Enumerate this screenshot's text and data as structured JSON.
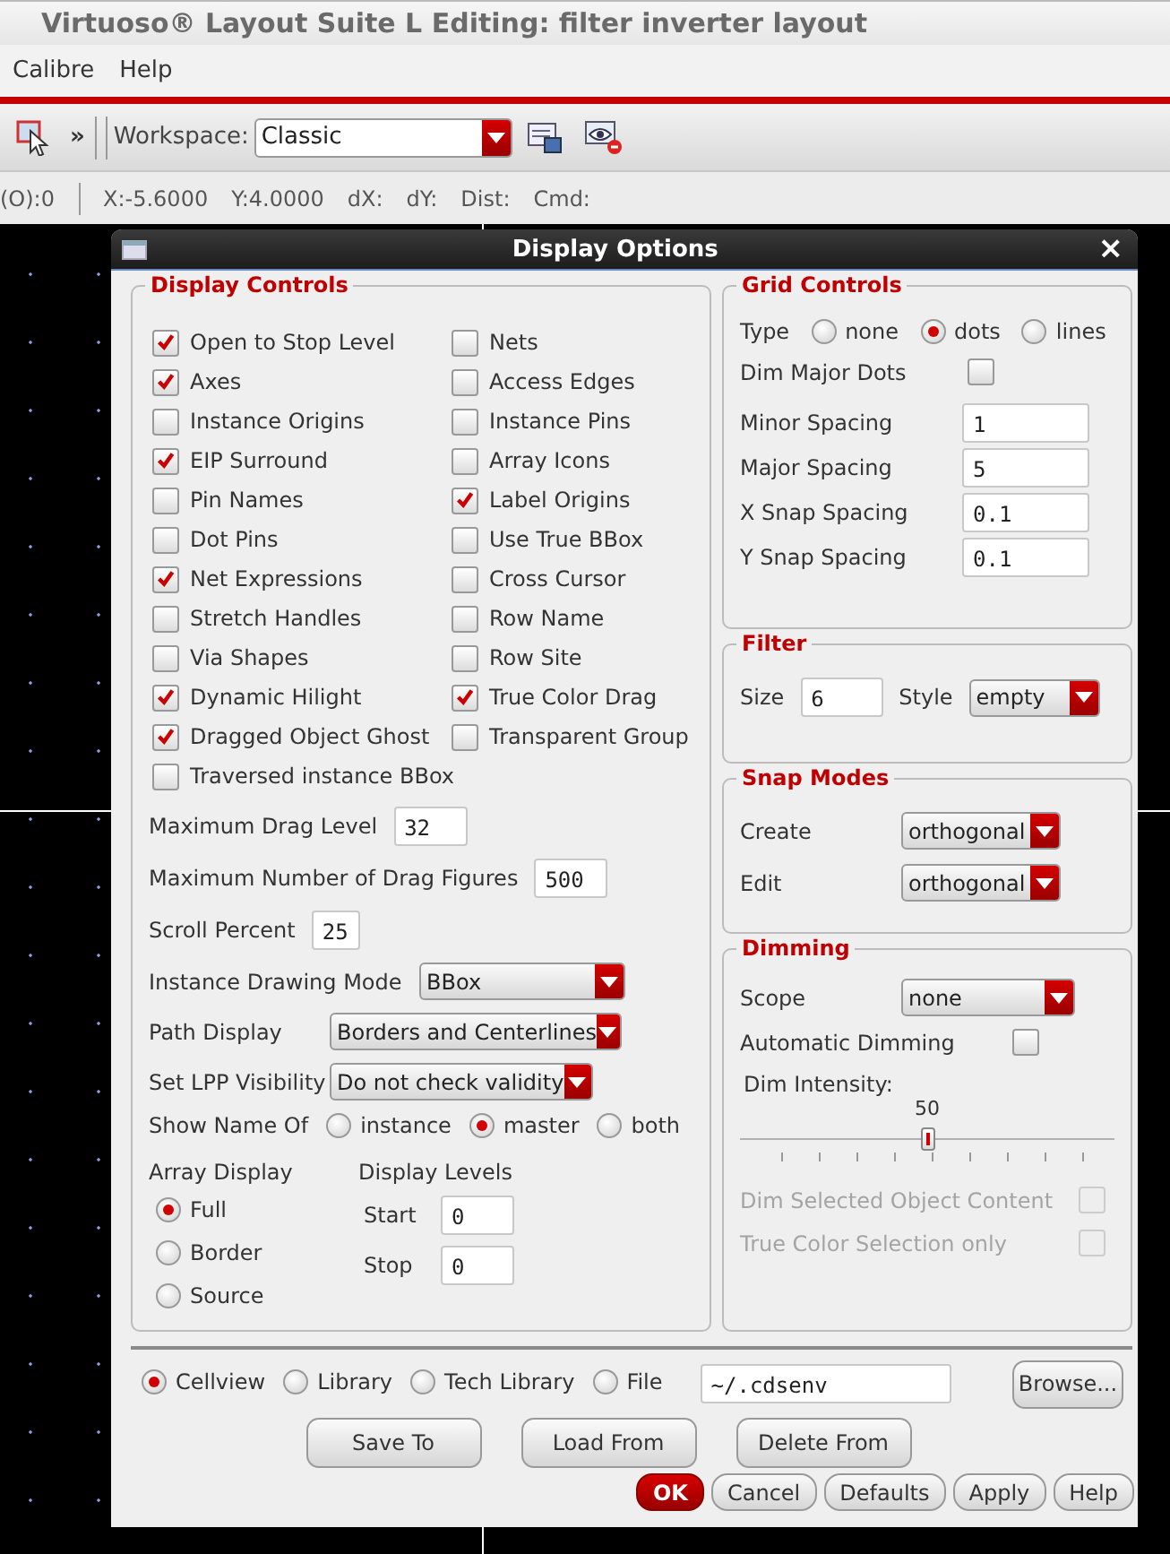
{
  "window": {
    "title": "Virtuoso® Layout Suite L Editing: filter inverter layout"
  },
  "menu_bar": [
    "Calibre",
    "Help"
  ],
  "toolbar": {
    "overflow": "»",
    "workspace_label": "Workspace:",
    "workspace": "Classic"
  },
  "status_bar": [
    "(O):0",
    "X:-5.6000",
    "Y:4.0000",
    "dX:",
    "dY:",
    "Dist:",
    "Cmd:"
  ],
  "dialog": {
    "title": "Display Options",
    "close": "×",
    "display_controls": {
      "title": "Display Controls",
      "column_1": [
        {
          "label": "Open to Stop Level",
          "checked": true
        },
        {
          "label": "Axes",
          "checked": true
        },
        {
          "label": "Instance Origins",
          "checked": false
        },
        {
          "label": "EIP Surround",
          "checked": true
        },
        {
          "label": "Pin Names",
          "checked": false
        },
        {
          "label": "Dot Pins",
          "checked": false
        },
        {
          "label": "Net Expressions",
          "checked": true
        },
        {
          "label": "Stretch Handles",
          "checked": false
        },
        {
          "label": "Via Shapes",
          "checked": false
        },
        {
          "label": "Dynamic Hilight",
          "checked": true
        },
        {
          "label": "Dragged Object Ghost",
          "checked": true
        },
        {
          "label": "Traversed instance BBox",
          "checked": false
        }
      ],
      "column_2": [
        {
          "label": "Nets",
          "checked": false
        },
        {
          "label": "Access Edges",
          "checked": false
        },
        {
          "label": "Instance Pins",
          "checked": false
        },
        {
          "label": "Array Icons",
          "checked": false
        },
        {
          "label": "Label Origins",
          "checked": true
        },
        {
          "label": "Use True BBox",
          "checked": false
        },
        {
          "label": "Cross Cursor",
          "checked": false
        },
        {
          "label": "Row Name",
          "checked": false
        },
        {
          "label": "Row Site",
          "checked": false
        },
        {
          "label": "True Color Drag",
          "checked": true
        },
        {
          "label": "Transparent Group",
          "checked": false
        }
      ],
      "fields": [
        {
          "label": "Maximum Drag Level",
          "value": "32"
        },
        {
          "label": "Maximum Number of Drag Figures",
          "value": "500"
        },
        {
          "label": "Scroll Percent",
          "value": "25"
        }
      ],
      "dropdowns": [
        {
          "label": "Instance Drawing Mode",
          "value": "BBox"
        },
        {
          "label": "Path Display",
          "value": "Borders and Centerlines"
        },
        {
          "label": "Set LPP Visibility",
          "value": "Do not check validity"
        }
      ],
      "show_name_of": {
        "label": "Show Name Of",
        "options": [
          {
            "label": "instance",
            "selected": false
          },
          {
            "label": "master",
            "selected": true
          },
          {
            "label": "both",
            "selected": false
          }
        ]
      },
      "array_display": {
        "label": "Array Display",
        "options": [
          {
            "label": "Full",
            "selected": true
          },
          {
            "label": "Border",
            "selected": false
          },
          {
            "label": "Source",
            "selected": false
          }
        ]
      },
      "display_levels": {
        "label": "Display Levels",
        "fields": [
          {
            "label": "Start",
            "value": "0"
          },
          {
            "label": "Stop",
            "value": "0"
          }
        ]
      }
    },
    "grid_controls": {
      "title": "Grid Controls",
      "type": {
        "label": "Type",
        "options": [
          {
            "label": "none",
            "selected": false
          },
          {
            "label": "dots",
            "selected": true
          },
          {
            "label": "lines",
            "selected": false
          }
        ]
      },
      "dim_major_dots": {
        "label": "Dim Major Dots",
        "checked": false
      },
      "fields": [
        {
          "label": "Minor Spacing",
          "value": "1"
        },
        {
          "label": "Major Spacing",
          "value": "5"
        },
        {
          "label": "X Snap Spacing",
          "value": "0.1"
        },
        {
          "label": "Y Snap Spacing",
          "value": "0.1"
        }
      ]
    },
    "filter": {
      "title": "Filter",
      "size": {
        "label": "Size",
        "value": "6"
      },
      "style": {
        "label": "Style",
        "value": "empty"
      }
    },
    "snap_modes": {
      "title": "Snap Modes",
      "dropdowns": [
        {
          "label": "Create",
          "value": "orthogonal"
        },
        {
          "label": "Edit",
          "value": "orthogonal"
        }
      ]
    },
    "dimming": {
      "title": "Dimming",
      "scope": {
        "label": "Scope",
        "value": "none"
      },
      "automatic_dimming": {
        "label": "Automatic Dimming",
        "checked": false
      },
      "intensity": {
        "label": "Dim Intensity:",
        "reading": "50",
        "level": 0.5
      },
      "options": [
        {
          "label": "Dim Selected Object Content",
          "checked": false,
          "disabled": true
        },
        {
          "label": "True Color Selection only",
          "checked": false,
          "disabled": true
        }
      ]
    },
    "source": {
      "options": [
        {
          "label": "Cellview",
          "selected": true
        },
        {
          "label": "Library",
          "selected": false
        },
        {
          "label": "Tech Library",
          "selected": false
        },
        {
          "label": "File",
          "selected": false
        }
      ],
      "path": "~/.cdsenv",
      "browse": "Browse..."
    },
    "actions": [
      "Save To",
      "Load From",
      "Delete From"
    ],
    "buttons": [
      {
        "label": "OK",
        "kind": "default"
      },
      {
        "label": "Cancel",
        "kind": "normal"
      },
      {
        "label": "Defaults",
        "kind": "normal"
      },
      {
        "label": "Apply",
        "kind": "normal"
      },
      {
        "label": "Help",
        "kind": "normal"
      }
    ]
  }
}
